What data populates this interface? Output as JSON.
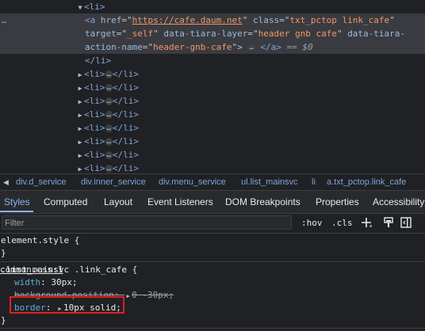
{
  "dom_tree": {
    "li_open": "<li>",
    "a_tag_open": "<a",
    "attr_href": "href",
    "href_value": "https://cafe.daum.net",
    "attr_class": "class",
    "class_value": "txt_pctop link_cafe",
    "attr_target": "target",
    "target_value": "_self",
    "attr_layer": "data-tiara-layer",
    "layer_value": "header gnb cafe",
    "attr_action_1": "data-tiara-",
    "attr_action_2": "action-name",
    "action_value": "header-gnb-cafe",
    "a_close": "</a>",
    "dollar_ref": "== $0",
    "li_close": "</li>",
    "collapsed_li_open": "<li>",
    "collapsed_li_close": "</li>",
    "ellipsis": "…"
  },
  "breadcrumb": [
    "div.d_service",
    "div.inner_service",
    "div.menu_service",
    "ul.list_mainsvc",
    "li",
    "a.txt_pctop.link_cafe"
  ],
  "tabs": [
    "Styles",
    "Computed",
    "Layout",
    "Event Listeners",
    "DOM Breakpoints",
    "Properties",
    "Accessibility"
  ],
  "filter": {
    "placeholder": "Filter",
    "hov": ":hov",
    "cls": ".cls"
  },
  "styles_pane": {
    "element_style": "element.style {",
    "close_brace": "}",
    "rule_selector": ".list_mainsvc .link_cafe {",
    "rule_source": "common.css:1",
    "props": [
      {
        "name": "width",
        "value": "30px",
        "struck": false
      },
      {
        "name": "background-position",
        "value": "0 -30px",
        "struck": true
      },
      {
        "name": "border",
        "value": "10px solid",
        "struck": false
      }
    ],
    "next_rule_partial": ".list_mainsvc .link_mainsvc {",
    "next_source_partial": "common.css:1"
  },
  "colors": {
    "background": "#202124",
    "selected_row": "#393b40",
    "tag": "#7fa6d6",
    "attr_value": "#f29766",
    "property": "#5db0d7",
    "active_tab": "#8ab4f8",
    "highlight": "#e21f1f"
  }
}
